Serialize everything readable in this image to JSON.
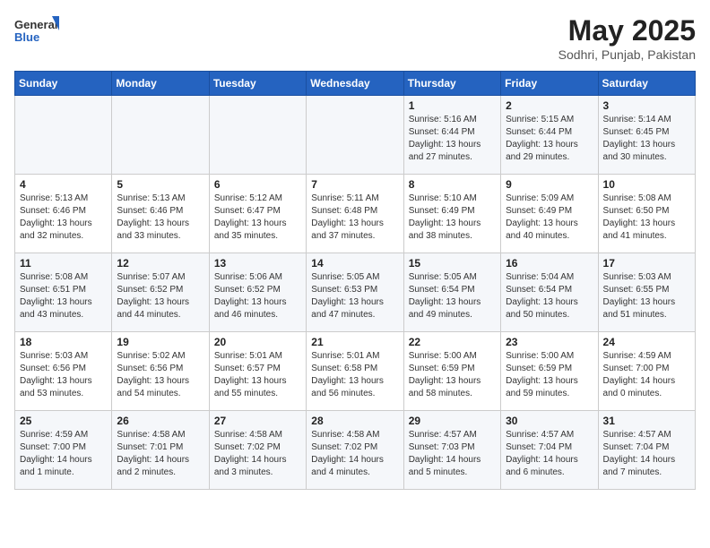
{
  "header": {
    "logo_general": "General",
    "logo_blue": "Blue",
    "title": "May 2025",
    "location": "Sodhri, Punjab, Pakistan"
  },
  "weekdays": [
    "Sunday",
    "Monday",
    "Tuesday",
    "Wednesday",
    "Thursday",
    "Friday",
    "Saturday"
  ],
  "weeks": [
    [
      {
        "day": "",
        "info": ""
      },
      {
        "day": "",
        "info": ""
      },
      {
        "day": "",
        "info": ""
      },
      {
        "day": "",
        "info": ""
      },
      {
        "day": "1",
        "info": "Sunrise: 5:16 AM\nSunset: 6:44 PM\nDaylight: 13 hours\nand 27 minutes."
      },
      {
        "day": "2",
        "info": "Sunrise: 5:15 AM\nSunset: 6:44 PM\nDaylight: 13 hours\nand 29 minutes."
      },
      {
        "day": "3",
        "info": "Sunrise: 5:14 AM\nSunset: 6:45 PM\nDaylight: 13 hours\nand 30 minutes."
      }
    ],
    [
      {
        "day": "4",
        "info": "Sunrise: 5:13 AM\nSunset: 6:46 PM\nDaylight: 13 hours\nand 32 minutes."
      },
      {
        "day": "5",
        "info": "Sunrise: 5:13 AM\nSunset: 6:46 PM\nDaylight: 13 hours\nand 33 minutes."
      },
      {
        "day": "6",
        "info": "Sunrise: 5:12 AM\nSunset: 6:47 PM\nDaylight: 13 hours\nand 35 minutes."
      },
      {
        "day": "7",
        "info": "Sunrise: 5:11 AM\nSunset: 6:48 PM\nDaylight: 13 hours\nand 37 minutes."
      },
      {
        "day": "8",
        "info": "Sunrise: 5:10 AM\nSunset: 6:49 PM\nDaylight: 13 hours\nand 38 minutes."
      },
      {
        "day": "9",
        "info": "Sunrise: 5:09 AM\nSunset: 6:49 PM\nDaylight: 13 hours\nand 40 minutes."
      },
      {
        "day": "10",
        "info": "Sunrise: 5:08 AM\nSunset: 6:50 PM\nDaylight: 13 hours\nand 41 minutes."
      }
    ],
    [
      {
        "day": "11",
        "info": "Sunrise: 5:08 AM\nSunset: 6:51 PM\nDaylight: 13 hours\nand 43 minutes."
      },
      {
        "day": "12",
        "info": "Sunrise: 5:07 AM\nSunset: 6:52 PM\nDaylight: 13 hours\nand 44 minutes."
      },
      {
        "day": "13",
        "info": "Sunrise: 5:06 AM\nSunset: 6:52 PM\nDaylight: 13 hours\nand 46 minutes."
      },
      {
        "day": "14",
        "info": "Sunrise: 5:05 AM\nSunset: 6:53 PM\nDaylight: 13 hours\nand 47 minutes."
      },
      {
        "day": "15",
        "info": "Sunrise: 5:05 AM\nSunset: 6:54 PM\nDaylight: 13 hours\nand 49 minutes."
      },
      {
        "day": "16",
        "info": "Sunrise: 5:04 AM\nSunset: 6:54 PM\nDaylight: 13 hours\nand 50 minutes."
      },
      {
        "day": "17",
        "info": "Sunrise: 5:03 AM\nSunset: 6:55 PM\nDaylight: 13 hours\nand 51 minutes."
      }
    ],
    [
      {
        "day": "18",
        "info": "Sunrise: 5:03 AM\nSunset: 6:56 PM\nDaylight: 13 hours\nand 53 minutes."
      },
      {
        "day": "19",
        "info": "Sunrise: 5:02 AM\nSunset: 6:56 PM\nDaylight: 13 hours\nand 54 minutes."
      },
      {
        "day": "20",
        "info": "Sunrise: 5:01 AM\nSunset: 6:57 PM\nDaylight: 13 hours\nand 55 minutes."
      },
      {
        "day": "21",
        "info": "Sunrise: 5:01 AM\nSunset: 6:58 PM\nDaylight: 13 hours\nand 56 minutes."
      },
      {
        "day": "22",
        "info": "Sunrise: 5:00 AM\nSunset: 6:59 PM\nDaylight: 13 hours\nand 58 minutes."
      },
      {
        "day": "23",
        "info": "Sunrise: 5:00 AM\nSunset: 6:59 PM\nDaylight: 13 hours\nand 59 minutes."
      },
      {
        "day": "24",
        "info": "Sunrise: 4:59 AM\nSunset: 7:00 PM\nDaylight: 14 hours\nand 0 minutes."
      }
    ],
    [
      {
        "day": "25",
        "info": "Sunrise: 4:59 AM\nSunset: 7:00 PM\nDaylight: 14 hours\nand 1 minute."
      },
      {
        "day": "26",
        "info": "Sunrise: 4:58 AM\nSunset: 7:01 PM\nDaylight: 14 hours\nand 2 minutes."
      },
      {
        "day": "27",
        "info": "Sunrise: 4:58 AM\nSunset: 7:02 PM\nDaylight: 14 hours\nand 3 minutes."
      },
      {
        "day": "28",
        "info": "Sunrise: 4:58 AM\nSunset: 7:02 PM\nDaylight: 14 hours\nand 4 minutes."
      },
      {
        "day": "29",
        "info": "Sunrise: 4:57 AM\nSunset: 7:03 PM\nDaylight: 14 hours\nand 5 minutes."
      },
      {
        "day": "30",
        "info": "Sunrise: 4:57 AM\nSunset: 7:04 PM\nDaylight: 14 hours\nand 6 minutes."
      },
      {
        "day": "31",
        "info": "Sunrise: 4:57 AM\nSunset: 7:04 PM\nDaylight: 14 hours\nand 7 minutes."
      }
    ]
  ]
}
